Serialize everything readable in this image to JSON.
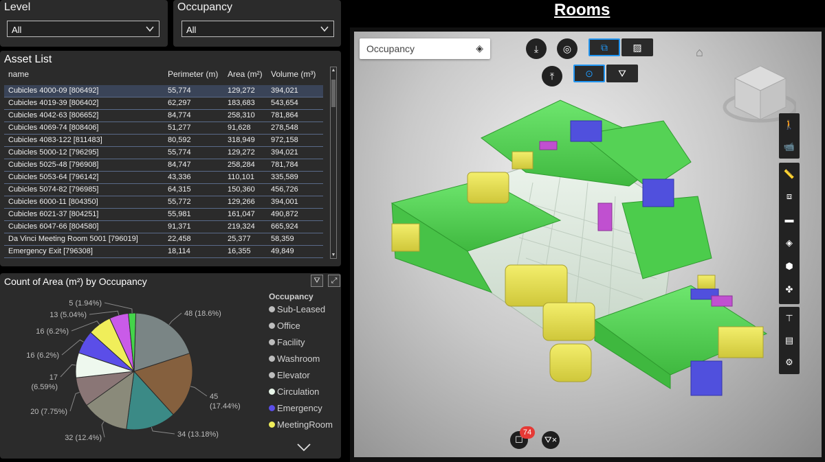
{
  "slicers": {
    "level": {
      "title": "Level",
      "value": "All"
    },
    "occupancy": {
      "title": "Occupancy",
      "value": "All"
    }
  },
  "asset_list": {
    "title": "Asset List",
    "columns": [
      "name",
      "Perimeter (m)",
      "Area (m²)",
      "Volume (m³)"
    ],
    "rows": [
      [
        "Cubicles 4000-09 [806492]",
        "55,774",
        "129,272",
        "394,021"
      ],
      [
        "Cubicles 4019-39 [806402]",
        "62,297",
        "183,683",
        "543,654"
      ],
      [
        "Cubicles 4042-63 [806652]",
        "84,774",
        "258,310",
        "781,864"
      ],
      [
        "Cubicles 4069-74 [808406]",
        "51,277",
        "91,628",
        "278,548"
      ],
      [
        "Cubicles 4083-122 [811483]",
        "80,592",
        "318,949",
        "972,158"
      ],
      [
        "Cubicles 5000-12 [796295]",
        "55,774",
        "129,272",
        "394,021"
      ],
      [
        "Cubicles 5025-48 [796908]",
        "84,747",
        "258,284",
        "781,784"
      ],
      [
        "Cubicles 5053-64 [796142]",
        "43,336",
        "110,101",
        "335,589"
      ],
      [
        "Cubicles 5074-82 [796985]",
        "64,315",
        "150,360",
        "456,726"
      ],
      [
        "Cubicles 6000-11 [804350]",
        "55,772",
        "129,266",
        "394,001"
      ],
      [
        "Cubicles 6021-37 [804251]",
        "55,981",
        "161,047",
        "490,872"
      ],
      [
        "Cubicles 6047-66 [804580]",
        "91,371",
        "219,324",
        "665,924"
      ],
      [
        "Da Vinci Meeting Room 5001 [796019]",
        "22,458",
        "25,377",
        "58,359"
      ],
      [
        "Emergency Exit [796308]",
        "18,114",
        "16,355",
        "49,849"
      ]
    ]
  },
  "pie": {
    "title": "Count of Area (m²) by Occupancy",
    "legend_title": "Occupancy",
    "legend": [
      {
        "name": "Sub-Leased",
        "color": "#bdbdbd"
      },
      {
        "name": "Office",
        "color": "#bdbdbd"
      },
      {
        "name": "Facility",
        "color": "#bdbdbd"
      },
      {
        "name": "Washroom",
        "color": "#bdbdbd"
      },
      {
        "name": "Elevator",
        "color": "#bdbdbd"
      },
      {
        "name": "Circulation",
        "color": "#e8f5e9"
      },
      {
        "name": "Emergency",
        "color": "#5b4ee8"
      },
      {
        "name": "MeetingRoom",
        "color": "#f0ee5a"
      }
    ],
    "labels": [
      "48 (18.6%)",
      "45\n(17.44%)",
      "34 (13.18%)",
      "32 (12.4%)",
      "20 (7.75%)",
      "17\n(6.59%)",
      "16 (6.2%)",
      "16 (6.2%)",
      "13 (5.04%)",
      "5 (1.94%)"
    ]
  },
  "chart_data": {
    "type": "pie",
    "title": "Count of Area (m²) by Occupancy",
    "legend_title": "Occupancy",
    "slices": [
      {
        "label": "48 (18.6%)",
        "value": 48,
        "color": "#7a8585"
      },
      {
        "label": "45 (17.44%)",
        "value": 45,
        "color": "#85603e"
      },
      {
        "label": "34 (13.18%)",
        "value": 34,
        "color": "#3b8a86"
      },
      {
        "label": "32 (12.4%)",
        "value": 32,
        "color": "#8a8a7a"
      },
      {
        "label": "20 (7.75%)",
        "value": 20,
        "color": "#8a7676"
      },
      {
        "label": "17 (6.59%)",
        "value": 17,
        "color": "#eef8ee"
      },
      {
        "label": "16 (6.2%)",
        "value": 16,
        "color": "#5b4ee8"
      },
      {
        "label": "16 (6.2%)",
        "value": 16,
        "color": "#f0ee5a"
      },
      {
        "label": "13 (5.04%)",
        "value": 13,
        "color": "#c95be8"
      },
      {
        "label": "5 (1.94%)",
        "value": 5,
        "color": "#44d44a"
      }
    ]
  },
  "viewer": {
    "title": "Rooms",
    "layer_select": "Occupancy",
    "badge_count": "74",
    "colors": {
      "green": "#4fd84f",
      "yellow": "#e8e048",
      "purple": "#5050dd",
      "magenta": "#c050d0",
      "pale": "#dfeee0"
    }
  }
}
